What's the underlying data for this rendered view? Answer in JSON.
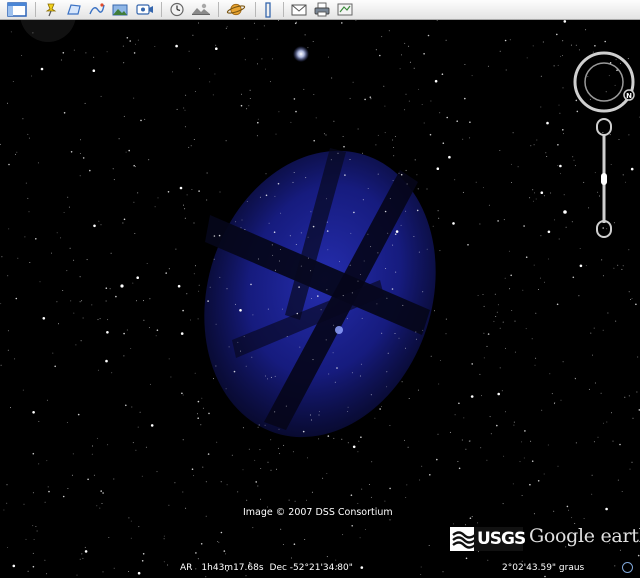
{
  "toolbar": {
    "buttons": [
      {
        "name": "sidebar-toggle",
        "icon": "sidebar-icon"
      },
      {
        "name": "add-placemark",
        "icon": "pushpin-icon"
      },
      {
        "name": "add-polygon",
        "icon": "polygon-icon"
      },
      {
        "name": "add-path",
        "icon": "path-icon"
      },
      {
        "name": "image-overlay",
        "icon": "image-overlay-icon"
      },
      {
        "name": "record-tour",
        "icon": "record-tour-icon"
      },
      {
        "name": "historical-imagery",
        "icon": "historical-imagery-icon"
      },
      {
        "name": "sunlight",
        "icon": "sunlight-icon"
      },
      {
        "name": "switch-planet",
        "icon": "planet-icon"
      },
      {
        "name": "ruler",
        "icon": "ruler-icon"
      },
      {
        "name": "email",
        "icon": "email-icon"
      },
      {
        "name": "print",
        "icon": "print-icon"
      },
      {
        "name": "view-in-maps",
        "icon": "map-icon"
      }
    ]
  },
  "view": {
    "attribution": "Image © 2007 DSS Consortium",
    "coords": {
      "ra_label": "AR",
      "ra_value": "1h43m17.68s",
      "dec_value": "Dec -52°21'34.80\""
    },
    "eye_alt": "2°02'43.59\" graus",
    "logos": {
      "usgs": "USGS",
      "google_earth": "Google earth"
    }
  },
  "colors": {
    "sky": "#000000",
    "nebula": "#1a1f8c",
    "toolbar_bg": "#ececec",
    "control_stroke": "#cfcfcf"
  }
}
